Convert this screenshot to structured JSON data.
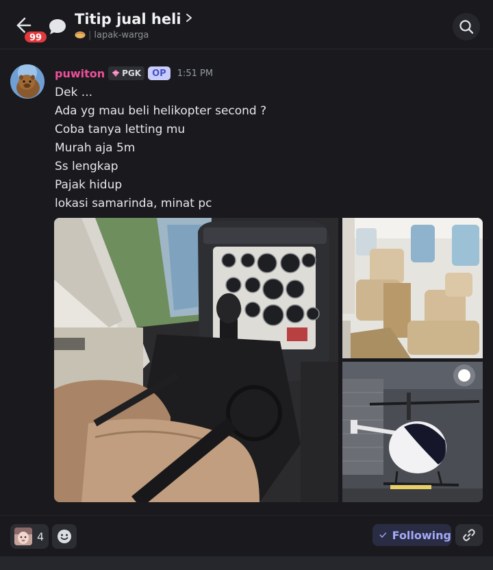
{
  "header": {
    "title": "Titip jual heli",
    "unread_badge": "99",
    "channel": "lapak-warga",
    "back_icon": "arrow-left-icon",
    "search_icon": "search-icon"
  },
  "message": {
    "username": "puwiton",
    "guild_tag": "PGK",
    "op_label": "OP",
    "timestamp": "1:51 PM",
    "lines": [
      "Dek ...",
      "Ada yg mau beli helikopter second ?",
      "Coba tanya letting mu",
      "Murah aja 5m",
      "Ss lengkap",
      "Pajak hidup",
      "lokasi samarinda, minat pc"
    ]
  },
  "footer": {
    "reaction_count": "4",
    "following_label": "Following"
  },
  "colors": {
    "background": "#1a1a1e",
    "username": "#f04f9a",
    "badge": "#e2393f",
    "following": "#a4aaf7",
    "op_chip": "#c9cdfb"
  }
}
